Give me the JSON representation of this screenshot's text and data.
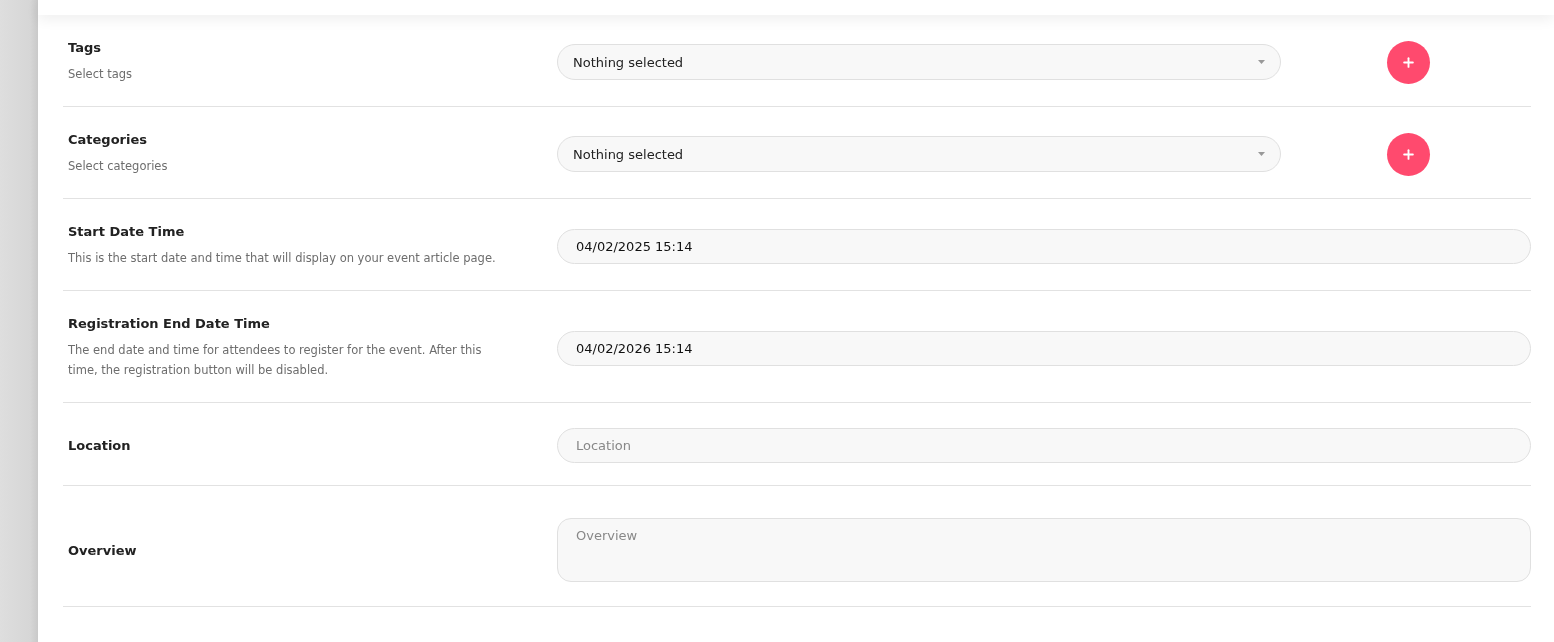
{
  "fields": [
    {
      "kind": "select",
      "label": "Tags",
      "description": "Select tags",
      "value": "Nothing selected",
      "add_button": true
    },
    {
      "kind": "select",
      "label": "Categories",
      "description": "Select categories",
      "value": "Nothing selected",
      "add_button": true
    },
    {
      "kind": "input",
      "label": "Start Date Time",
      "description": "This is the start date and time that will display on your event article page.",
      "value": "04/02/2025 15:14"
    },
    {
      "kind": "input",
      "label": "Registration End Date Time",
      "description": "The end date and time for attendees to register for the event. After this time, the registration button will be disabled.",
      "value": "04/02/2026 15:14"
    },
    {
      "kind": "input",
      "label": "Location",
      "placeholder": "Location"
    },
    {
      "kind": "textarea",
      "label": "Overview",
      "placeholder": "Overview"
    }
  ]
}
